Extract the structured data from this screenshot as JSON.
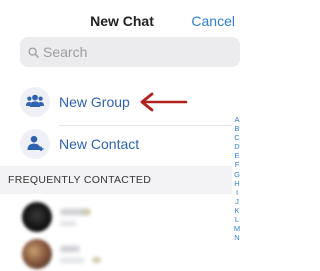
{
  "header": {
    "title": "New Chat",
    "cancel_label": "Cancel"
  },
  "search": {
    "placeholder": "Search",
    "value": ""
  },
  "actions": [
    {
      "label": "New Group",
      "icon": "group-icon"
    },
    {
      "label": "New Contact",
      "icon": "contact-icon"
    }
  ],
  "section": {
    "title": "FREQUENTLY CONTACTED"
  },
  "contacts_note": "names blurred",
  "alphabet": [
    "A",
    "B",
    "C",
    "D",
    "E",
    "F",
    "G",
    "H",
    "I",
    "J",
    "K",
    "L",
    "M",
    "N"
  ],
  "colors": {
    "accent": "#2f80d6",
    "label_blue": "#2f63b0",
    "arrow": "#b0201c"
  }
}
